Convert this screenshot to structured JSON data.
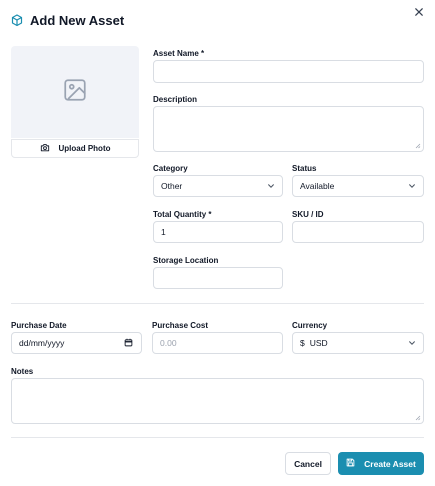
{
  "dialog": {
    "title": "Add New Asset",
    "icons": {
      "title": "cube-icon",
      "close": "close-icon"
    }
  },
  "photo": {
    "upload_label": "Upload Photo",
    "icons": {
      "placeholder": "image-icon",
      "upload": "camera-icon"
    }
  },
  "form": {
    "asset_name": {
      "label": "Asset Name *",
      "value": ""
    },
    "description": {
      "label": "Description",
      "value": ""
    },
    "category": {
      "label": "Category",
      "value": "Other"
    },
    "status": {
      "label": "Status",
      "value": "Available"
    },
    "total_quantity": {
      "label": "Total Quantity *",
      "value": "1"
    },
    "sku": {
      "label": "SKU / ID",
      "value": ""
    },
    "storage_location": {
      "label": "Storage Location",
      "value": ""
    },
    "purchase_date": {
      "label": "Purchase Date",
      "value": "dd/mm/yyyy"
    },
    "purchase_cost": {
      "label": "Purchase Cost",
      "placeholder": "0.00"
    },
    "currency": {
      "label": "Currency",
      "symbol": "$",
      "value": "USD"
    },
    "notes": {
      "label": "Notes",
      "value": ""
    }
  },
  "footer": {
    "cancel_label": "Cancel",
    "create_label": "Create Asset",
    "icons": {
      "create": "save-icon"
    }
  },
  "colors": {
    "accent": "#1b8eb0",
    "border": "#d9dde3",
    "photo_bg": "#f1f3f8"
  }
}
